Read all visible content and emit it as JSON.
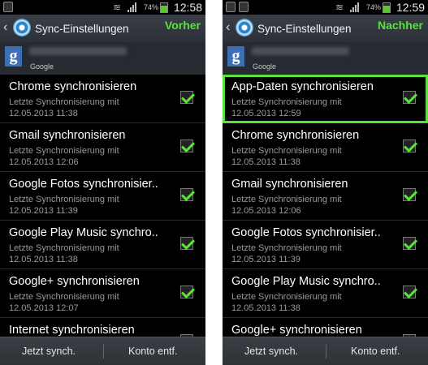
{
  "screens": [
    {
      "status": {
        "battery_percent": "74%",
        "time": "12:58"
      },
      "title": "Sync-Einstellungen",
      "label": "Vorher",
      "account": {
        "label": "Google"
      },
      "items": [
        {
          "title": "Chrome synchronisieren",
          "sub": "Letzte Synchronisierung mit",
          "date": "12.05.2013 11:38",
          "checked": true
        },
        {
          "title": "Gmail synchronisieren",
          "sub": "Letzte Synchronisierung mit",
          "date": "12.05.2013 12:06",
          "checked": true
        },
        {
          "title": "Google Fotos synchronisier..",
          "sub": "Letzte Synchronisierung mit",
          "date": "12.05.2013 11:39",
          "checked": true
        },
        {
          "title": "Google Play Music synchro..",
          "sub": "Letzte Synchronisierung mit",
          "date": "12.05.2013 11:38",
          "checked": true
        },
        {
          "title": "Google+ synchronisieren",
          "sub": "Letzte Synchronisierung mit",
          "date": "12.05.2013 12:07",
          "checked": true
        },
        {
          "title": "Internet synchronisieren",
          "sub": "",
          "date": "",
          "checked": true
        }
      ],
      "buttons": {
        "sync_now": "Jetzt synch.",
        "remove_account": "Konto entf."
      }
    },
    {
      "status": {
        "battery_percent": "74%",
        "time": "12:59"
      },
      "title": "Sync-Einstellungen",
      "label": "Nachher",
      "account": {
        "label": "Google"
      },
      "items": [
        {
          "title": "App-Daten synchronisieren",
          "sub": "Letzte Synchronisierung mit",
          "date": "12.05.2013 12:59",
          "checked": true,
          "highlighted": true
        },
        {
          "title": "Chrome synchronisieren",
          "sub": "Letzte Synchronisierung mit",
          "date": "12.05.2013 11:38",
          "checked": true
        },
        {
          "title": "Gmail synchronisieren",
          "sub": "Letzte Synchronisierung mit",
          "date": "12.05.2013 12:06",
          "checked": true
        },
        {
          "title": "Google Fotos synchronisier..",
          "sub": "Letzte Synchronisierung mit",
          "date": "12.05.2013 11:39",
          "checked": true
        },
        {
          "title": "Google Play Music synchro..",
          "sub": "Letzte Synchronisierung mit",
          "date": "12.05.2013 11:38",
          "checked": true
        },
        {
          "title": "Google+ synchronisieren",
          "sub": "",
          "date": "",
          "checked": true
        }
      ],
      "buttons": {
        "sync_now": "Jetzt synch.",
        "remove_account": "Konto entf."
      }
    }
  ],
  "colors": {
    "accent_green": "#5ae13c",
    "action_bar": "#2b3038",
    "background": "#000000"
  },
  "icons": [
    "back-icon",
    "gear-icon",
    "google-account-icon",
    "checkbox-checked-icon",
    "battery-icon",
    "signal-icon",
    "wifi-icon"
  ]
}
